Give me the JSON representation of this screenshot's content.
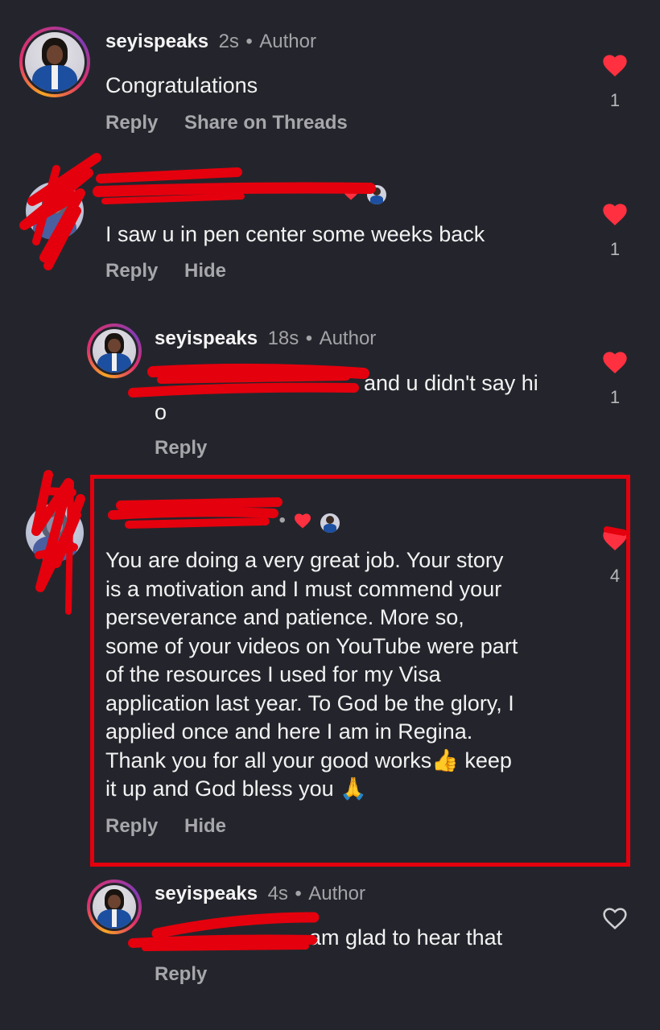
{
  "comments": [
    {
      "username": "seyispeaks",
      "time": "2s",
      "sep": "•",
      "badge": "Author",
      "text": "Congratulations",
      "actions": [
        "Reply",
        "Share on Threads"
      ],
      "like_count": "1",
      "liked": true
    },
    {
      "username": "",
      "time": "",
      "text": "I saw u in pen center some weeks back",
      "actions": [
        "Reply",
        "Hide"
      ],
      "like_count": "1",
      "liked": true
    },
    {
      "username": "seyispeaks",
      "time": "18s",
      "sep": "•",
      "badge": "Author",
      "text_after_mention": "and u didn't say hi",
      "text_line2": "o",
      "actions": [
        "Reply"
      ],
      "like_count": "1",
      "liked": true
    },
    {
      "username": "",
      "time": "",
      "sep": "•",
      "text_lines": [
        "You are doing a very great job. Your story",
        "is a motivation and I must commend your",
        "perseverance and patience. More so,",
        "some of your videos on YouTube were part",
        "of the resources I used for my Visa",
        "application last year. To God be the glory, I",
        "applied once and here I am in Regina.",
        "Thank you for all your good works👍 keep",
        "it up and God bless you 🙏"
      ],
      "actions": [
        "Reply",
        "Hide"
      ],
      "like_count": "4",
      "liked": true
    },
    {
      "username": "seyispeaks",
      "time": "4s",
      "sep": "•",
      "badge": "Author",
      "text_after_mention": "am glad to hear that",
      "actions": [
        "Reply"
      ],
      "like_count": "",
      "liked": false
    }
  ],
  "icons": {
    "heart_filled": "heart-filled-icon",
    "heart_outline": "heart-outline-icon",
    "author_liked": "author-liked-icon"
  },
  "colors": {
    "background": "#24252c",
    "heart": "#ff3040",
    "annotation_red": "#e4000d",
    "secondary_text": "#a3a3a8"
  }
}
